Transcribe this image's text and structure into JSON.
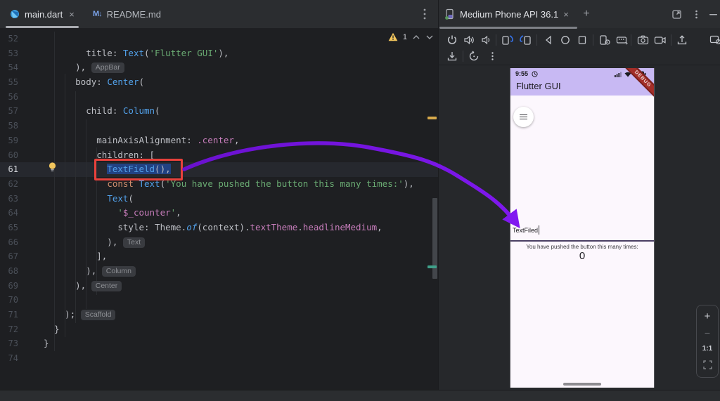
{
  "editor": {
    "tabs": [
      {
        "label": "main.dart",
        "close_glyph": "×",
        "active": true,
        "icon": "dart-file-icon"
      },
      {
        "label": "README.md",
        "active": false,
        "icon": "markdown-file-icon",
        "icon_glyph": "M↓"
      }
    ],
    "more_menu_icon": "kebab-menu-icon",
    "warning": {
      "count": "1",
      "icons": [
        "warning-triangle-icon",
        "prev-warning-chevron-icon",
        "next-warning-chevron-icon"
      ]
    },
    "lines": [
      {
        "n": "52",
        "segs": []
      },
      {
        "n": "53",
        "segs": [
          {
            "t": "        title: ",
            "c": "p"
          },
          {
            "t": "Text",
            "c": "cls"
          },
          {
            "t": "(",
            "c": "p"
          },
          {
            "t": "'Flutter GUI'",
            "c": "str"
          },
          {
            "t": "),",
            "c": "p"
          }
        ]
      },
      {
        "n": "54",
        "segs": [
          {
            "t": "      ), ",
            "c": "p"
          },
          {
            "t": "AppBar",
            "c": "inlay"
          }
        ]
      },
      {
        "n": "55",
        "segs": [
          {
            "t": "      body: ",
            "c": "p"
          },
          {
            "t": "Center",
            "c": "cls"
          },
          {
            "t": "(",
            "c": "p"
          }
        ]
      },
      {
        "n": "56",
        "segs": []
      },
      {
        "n": "57",
        "segs": [
          {
            "t": "        child: ",
            "c": "p"
          },
          {
            "t": "Column",
            "c": "cls"
          },
          {
            "t": "(",
            "c": "p"
          }
        ]
      },
      {
        "n": "58",
        "segs": []
      },
      {
        "n": "59",
        "segs": [
          {
            "t": "          mainAxisAlignment: ",
            "c": "p"
          },
          {
            "t": ".center",
            "c": "prop"
          },
          {
            "t": ",",
            "c": "p"
          }
        ]
      },
      {
        "n": "60",
        "segs": [
          {
            "t": "          children: [",
            "c": "p"
          }
        ]
      },
      {
        "n": "61",
        "current": true,
        "segs": [
          {
            "t": "            ",
            "c": "p"
          },
          {
            "t": "TextField",
            "c": "sel-cls"
          },
          {
            "t": "(),",
            "c": "sel-p"
          }
        ]
      },
      {
        "n": "62",
        "segs": [
          {
            "t": "            ",
            "c": "p"
          },
          {
            "t": "const",
            "c": "kw"
          },
          {
            "t": " ",
            "c": "p"
          },
          {
            "t": "Text",
            "c": "cls"
          },
          {
            "t": "(",
            "c": "p"
          },
          {
            "t": "'You have pushed the button this many times:'",
            "c": "str"
          },
          {
            "t": "),",
            "c": "p"
          }
        ]
      },
      {
        "n": "63",
        "segs": [
          {
            "t": "            ",
            "c": "p"
          },
          {
            "t": "Text",
            "c": "cls"
          },
          {
            "t": "(",
            "c": "p"
          }
        ]
      },
      {
        "n": "64",
        "segs": [
          {
            "t": "              ",
            "c": "p"
          },
          {
            "t": "'",
            "c": "str"
          },
          {
            "t": "$_counter",
            "c": "prop"
          },
          {
            "t": "'",
            "c": "str"
          },
          {
            "t": ",",
            "c": "p"
          }
        ]
      },
      {
        "n": "65",
        "segs": [
          {
            "t": "              style: Theme.",
            "c": "p"
          },
          {
            "t": "of",
            "c": "ital"
          },
          {
            "t": "(context).",
            "c": "p"
          },
          {
            "t": "textTheme",
            "c": "prop"
          },
          {
            "t": ".",
            "c": "p"
          },
          {
            "t": "headlineMedium",
            "c": "prop"
          },
          {
            "t": ",",
            "c": "p"
          }
        ]
      },
      {
        "n": "66",
        "segs": [
          {
            "t": "            ), ",
            "c": "p"
          },
          {
            "t": "Text",
            "c": "inlay"
          }
        ]
      },
      {
        "n": "67",
        "segs": [
          {
            "t": "          ],",
            "c": "p"
          }
        ]
      },
      {
        "n": "68",
        "segs": [
          {
            "t": "        ), ",
            "c": "p"
          },
          {
            "t": "Column",
            "c": "inlay"
          }
        ]
      },
      {
        "n": "69",
        "segs": [
          {
            "t": "      ), ",
            "c": "p"
          },
          {
            "t": "Center",
            "c": "inlay"
          }
        ]
      },
      {
        "n": "70",
        "segs": []
      },
      {
        "n": "71",
        "segs": [
          {
            "t": "    ); ",
            "c": "p"
          },
          {
            "t": "Scaffold",
            "c": "inlay"
          }
        ]
      },
      {
        "n": "72",
        "segs": [
          {
            "t": "  }",
            "c": "p"
          }
        ]
      },
      {
        "n": "73",
        "segs": [
          {
            "t": "}",
            "c": "p"
          }
        ]
      },
      {
        "n": "74",
        "segs": []
      }
    ],
    "annotations": {
      "highlight_box": "red-highlight-box",
      "intention_bulb": "lightbulb-icon"
    }
  },
  "device_panel": {
    "tab": {
      "label": "Medium Phone API 36.1",
      "close_glyph": "×",
      "new_tab_glyph": "+",
      "icon": "device-phone-icon"
    },
    "header_icons": [
      "open-in-window-icon",
      "kebab-menu-icon",
      "hide-panel-icon"
    ],
    "toolbar_row1_icons": [
      "power-icon",
      "volume-up-icon",
      "volume-down-icon",
      "rotate-left-icon",
      "rotate-right-icon",
      "back-icon",
      "home-icon",
      "overview-icon",
      "device-settings-icon",
      "virtual-input-icon",
      "screenshot-icon",
      "screen-record-icon",
      "upload-icon",
      "device-explorer-icon"
    ],
    "toolbar_row2_icons": [
      "install-icon",
      "reset-icon",
      "kebab-menu-icon"
    ],
    "zoom_controls": {
      "zoom_in_glyph": "+",
      "zoom_out_glyph": "−",
      "ratio_label": "1:1",
      "fit_icon": "fit-to-window-icon"
    }
  },
  "phone": {
    "status_time": "9:55",
    "status_icons": [
      "profile-circle-icon",
      "signal-icon",
      "wifi-icon",
      "battery-icon"
    ],
    "app_title": "Flutter GUI",
    "debug_banner": "DEBUG",
    "menu_fab_icon": "hamburger-icon",
    "textfield_value": "TextFiled",
    "counter_caption": "You have pushed the button this many times:",
    "counter_value": "0"
  },
  "colors": {
    "editor_bg": "#1e1f22",
    "panel_bg": "#26282b",
    "header_bg": "#2b2d30",
    "selection": "#214283",
    "red_box": "#e8413c",
    "warning_yellow": "#f2c55c",
    "arrow_purple": "#7a18e8",
    "appbar_lavender": "#c8b9f3",
    "phone_body": "#fcf7fd",
    "debug_red": "#a42e28",
    "blue_accent": "#3574f0"
  }
}
